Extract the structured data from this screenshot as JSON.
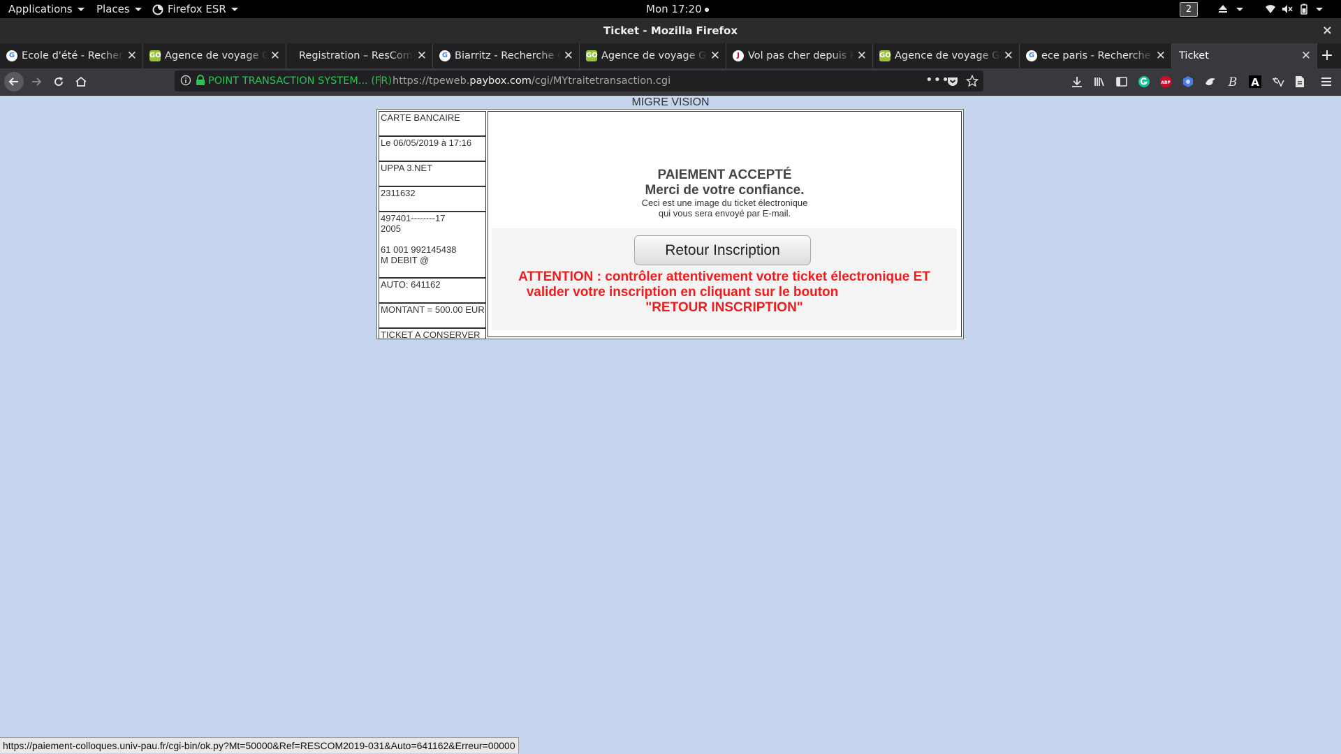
{
  "topbar": {
    "applications": "Applications",
    "places": "Places",
    "firefox": "Firefox ESR",
    "clock": "Mon 17:20",
    "workspace": "2"
  },
  "window": {
    "title": "Ticket - Mozilla Firefox",
    "close": "×"
  },
  "tabs": [
    {
      "label": "Ecole d'été - Recherche",
      "favicon": "google"
    },
    {
      "label": "Agence de voyage GO Voyages",
      "favicon": "go"
    },
    {
      "label": "Registration – ResCom Summer",
      "favicon": "none"
    },
    {
      "label": "Biarritz - Recherche Google",
      "favicon": "google"
    },
    {
      "label": "Agence de voyage GO Voyages",
      "favicon": "go"
    },
    {
      "label": "Vol pas cher depuis Paris",
      "favicon": "opodo"
    },
    {
      "label": "Agence de voyage GO Voyages",
      "favicon": "go"
    },
    {
      "label": "ece paris - Recherche Google",
      "favicon": "google"
    },
    {
      "label": "Ticket",
      "favicon": "none",
      "active": true
    }
  ],
  "toolbar": {
    "identity": "POINT TRANSACTION SYSTEM... (FR)",
    "url_prefix": "https://tpeweb.",
    "url_host": "paybox.com",
    "url_path": "/cgi/MYtraitetransaction.cgi",
    "more": "•••"
  },
  "page": {
    "merchant": "MIGRE VISION",
    "ticket": {
      "card_type": "CARTE BANCAIRE",
      "date": "Le 06/05/2019 à 17:16",
      "shop": "UPPA 3.NET",
      "shop_id": "2311632",
      "card_number": "497401--------17",
      "expiry": "2005",
      "terminal": "61 001 992145438",
      "debit": "M DEBIT @",
      "auth": "AUTO: 641162",
      "amount": "MONTANT = 500.00 EUR",
      "keep": "TICKET A CONSERVER"
    },
    "message": {
      "accepted": "PAIEMENT ACCEPTÉ",
      "thanks": "Merci de votre confiance.",
      "note_line1": "Ceci est une image du ticket électronique",
      "note_line2": "qui vous sera envoyé par E-mail."
    },
    "button_label": "Retour Inscription",
    "warning": {
      "line1": "ATTENTION : contrôler attentivement votre ticket électronique ET",
      "line2": "valider votre inscription en cliquant sur le bouton",
      "line3": "\"RETOUR INSCRIPTION\""
    }
  },
  "status_bar": {
    "link": "https://paiement-colloques.univ-pau.fr/cgi-bin/ok.py?Mt=50000&Ref=RESCOM2019-031&Auto=641162&Erreur=00000"
  },
  "colors": {
    "page_background": "#c5d5ee",
    "warning_red": "#ee1c1c",
    "secure_green": "#30c052",
    "chrome_dark": "#38383d"
  }
}
